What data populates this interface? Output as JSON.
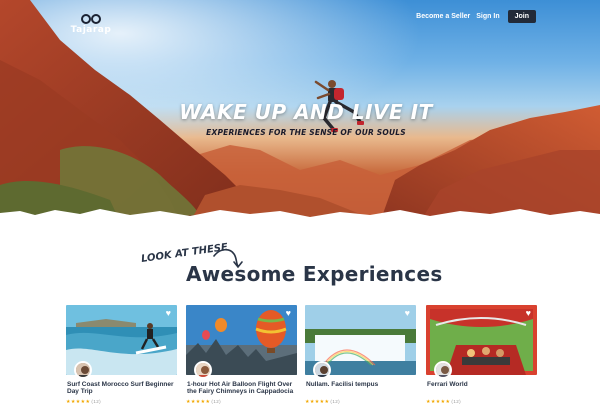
{
  "header": {
    "brand": "Tajarap",
    "nav": {
      "seller": "Become a Seller",
      "signin": "Sign In",
      "join": "Join"
    }
  },
  "hero": {
    "headline": "WAKE UP AND LIVE IT",
    "subhead": "EXPERIENCES FOR THE SENSE OF OUR SOULS"
  },
  "section": {
    "kicker": "LOOK AT THESE",
    "title": "Awesome Experiences"
  },
  "cards": [
    {
      "title": "Surf Coast Morocco  Surf Beginner Day Trip",
      "stars": "★★★★★",
      "count": "(12)"
    },
    {
      "title": "1-hour Hot Air Balloon Flight Over the Fairy Chimneys in Cappadocia",
      "stars": "★★★★★",
      "count": "(12)"
    },
    {
      "title": "Nullam. Facilisi tempus",
      "stars": "★★★★★",
      "count": "(12)"
    },
    {
      "title": "Ferrari World",
      "stars": "★★★★★",
      "count": "(12)"
    }
  ],
  "icons": {
    "logo": "infinity-glasses-icon",
    "heart": "heart-icon",
    "star": "star-icon"
  },
  "colors": {
    "navy": "#2a3547",
    "star": "#f2a800",
    "join_bg": "#222a38"
  }
}
